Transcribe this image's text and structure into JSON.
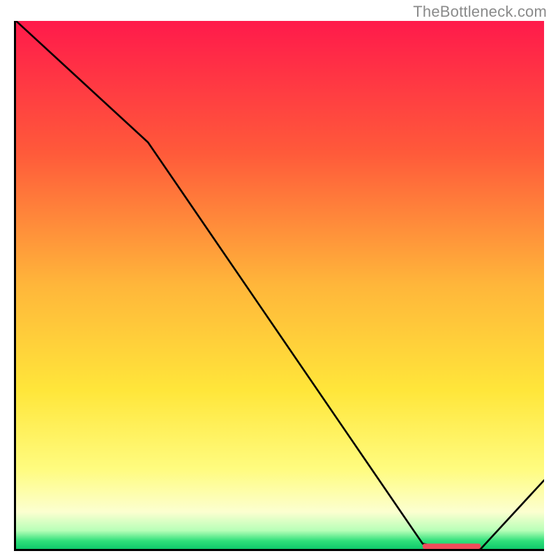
{
  "watermark": "TheBottleneck.com",
  "chart_data": {
    "type": "line",
    "title": "",
    "xlabel": "",
    "ylabel": "",
    "xlim": [
      0,
      100
    ],
    "ylim": [
      0,
      100
    ],
    "x": [
      0,
      25,
      77,
      82,
      88,
      100
    ],
    "values": [
      100,
      77,
      1,
      0,
      0,
      13
    ],
    "gradient_stops": [
      {
        "offset": 0.0,
        "color": "#ff1a4b"
      },
      {
        "offset": 0.25,
        "color": "#ff5a3a"
      },
      {
        "offset": 0.5,
        "color": "#ffb63a"
      },
      {
        "offset": 0.7,
        "color": "#ffe63a"
      },
      {
        "offset": 0.85,
        "color": "#fffc80"
      },
      {
        "offset": 0.93,
        "color": "#fcffd0"
      },
      {
        "offset": 0.965,
        "color": "#b8ffb8"
      },
      {
        "offset": 0.985,
        "color": "#2fe07a"
      },
      {
        "offset": 1.0,
        "color": "#0fc96b"
      }
    ],
    "marker_band": {
      "x_start": 77,
      "x_end": 88,
      "y": 0.5,
      "color": "#f04b5a"
    }
  }
}
